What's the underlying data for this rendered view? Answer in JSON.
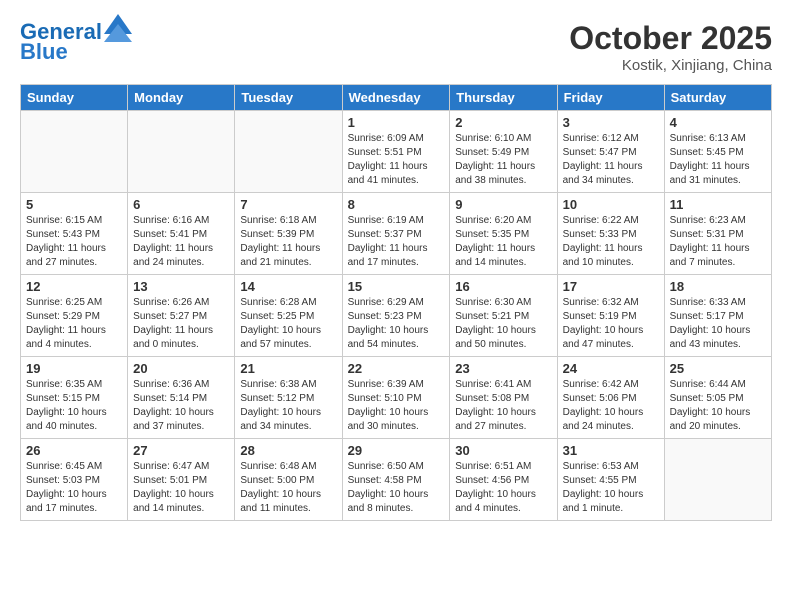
{
  "header": {
    "logo_line1": "General",
    "logo_line2": "Blue",
    "month": "October 2025",
    "location": "Kostik, Xinjiang, China"
  },
  "days_of_week": [
    "Sunday",
    "Monday",
    "Tuesday",
    "Wednesday",
    "Thursday",
    "Friday",
    "Saturday"
  ],
  "weeks": [
    [
      {
        "day": "",
        "info": ""
      },
      {
        "day": "",
        "info": ""
      },
      {
        "day": "",
        "info": ""
      },
      {
        "day": "1",
        "info": "Sunrise: 6:09 AM\nSunset: 5:51 PM\nDaylight: 11 hours\nand 41 minutes."
      },
      {
        "day": "2",
        "info": "Sunrise: 6:10 AM\nSunset: 5:49 PM\nDaylight: 11 hours\nand 38 minutes."
      },
      {
        "day": "3",
        "info": "Sunrise: 6:12 AM\nSunset: 5:47 PM\nDaylight: 11 hours\nand 34 minutes."
      },
      {
        "day": "4",
        "info": "Sunrise: 6:13 AM\nSunset: 5:45 PM\nDaylight: 11 hours\nand 31 minutes."
      }
    ],
    [
      {
        "day": "5",
        "info": "Sunrise: 6:15 AM\nSunset: 5:43 PM\nDaylight: 11 hours\nand 27 minutes."
      },
      {
        "day": "6",
        "info": "Sunrise: 6:16 AM\nSunset: 5:41 PM\nDaylight: 11 hours\nand 24 minutes."
      },
      {
        "day": "7",
        "info": "Sunrise: 6:18 AM\nSunset: 5:39 PM\nDaylight: 11 hours\nand 21 minutes."
      },
      {
        "day": "8",
        "info": "Sunrise: 6:19 AM\nSunset: 5:37 PM\nDaylight: 11 hours\nand 17 minutes."
      },
      {
        "day": "9",
        "info": "Sunrise: 6:20 AM\nSunset: 5:35 PM\nDaylight: 11 hours\nand 14 minutes."
      },
      {
        "day": "10",
        "info": "Sunrise: 6:22 AM\nSunset: 5:33 PM\nDaylight: 11 hours\nand 10 minutes."
      },
      {
        "day": "11",
        "info": "Sunrise: 6:23 AM\nSunset: 5:31 PM\nDaylight: 11 hours\nand 7 minutes."
      }
    ],
    [
      {
        "day": "12",
        "info": "Sunrise: 6:25 AM\nSunset: 5:29 PM\nDaylight: 11 hours\nand 4 minutes."
      },
      {
        "day": "13",
        "info": "Sunrise: 6:26 AM\nSunset: 5:27 PM\nDaylight: 11 hours\nand 0 minutes."
      },
      {
        "day": "14",
        "info": "Sunrise: 6:28 AM\nSunset: 5:25 PM\nDaylight: 10 hours\nand 57 minutes."
      },
      {
        "day": "15",
        "info": "Sunrise: 6:29 AM\nSunset: 5:23 PM\nDaylight: 10 hours\nand 54 minutes."
      },
      {
        "day": "16",
        "info": "Sunrise: 6:30 AM\nSunset: 5:21 PM\nDaylight: 10 hours\nand 50 minutes."
      },
      {
        "day": "17",
        "info": "Sunrise: 6:32 AM\nSunset: 5:19 PM\nDaylight: 10 hours\nand 47 minutes."
      },
      {
        "day": "18",
        "info": "Sunrise: 6:33 AM\nSunset: 5:17 PM\nDaylight: 10 hours\nand 43 minutes."
      }
    ],
    [
      {
        "day": "19",
        "info": "Sunrise: 6:35 AM\nSunset: 5:15 PM\nDaylight: 10 hours\nand 40 minutes."
      },
      {
        "day": "20",
        "info": "Sunrise: 6:36 AM\nSunset: 5:14 PM\nDaylight: 10 hours\nand 37 minutes."
      },
      {
        "day": "21",
        "info": "Sunrise: 6:38 AM\nSunset: 5:12 PM\nDaylight: 10 hours\nand 34 minutes."
      },
      {
        "day": "22",
        "info": "Sunrise: 6:39 AM\nSunset: 5:10 PM\nDaylight: 10 hours\nand 30 minutes."
      },
      {
        "day": "23",
        "info": "Sunrise: 6:41 AM\nSunset: 5:08 PM\nDaylight: 10 hours\nand 27 minutes."
      },
      {
        "day": "24",
        "info": "Sunrise: 6:42 AM\nSunset: 5:06 PM\nDaylight: 10 hours\nand 24 minutes."
      },
      {
        "day": "25",
        "info": "Sunrise: 6:44 AM\nSunset: 5:05 PM\nDaylight: 10 hours\nand 20 minutes."
      }
    ],
    [
      {
        "day": "26",
        "info": "Sunrise: 6:45 AM\nSunset: 5:03 PM\nDaylight: 10 hours\nand 17 minutes."
      },
      {
        "day": "27",
        "info": "Sunrise: 6:47 AM\nSunset: 5:01 PM\nDaylight: 10 hours\nand 14 minutes."
      },
      {
        "day": "28",
        "info": "Sunrise: 6:48 AM\nSunset: 5:00 PM\nDaylight: 10 hours\nand 11 minutes."
      },
      {
        "day": "29",
        "info": "Sunrise: 6:50 AM\nSunset: 4:58 PM\nDaylight: 10 hours\nand 8 minutes."
      },
      {
        "day": "30",
        "info": "Sunrise: 6:51 AM\nSunset: 4:56 PM\nDaylight: 10 hours\nand 4 minutes."
      },
      {
        "day": "31",
        "info": "Sunrise: 6:53 AM\nSunset: 4:55 PM\nDaylight: 10 hours\nand 1 minute."
      },
      {
        "day": "",
        "info": ""
      }
    ]
  ]
}
